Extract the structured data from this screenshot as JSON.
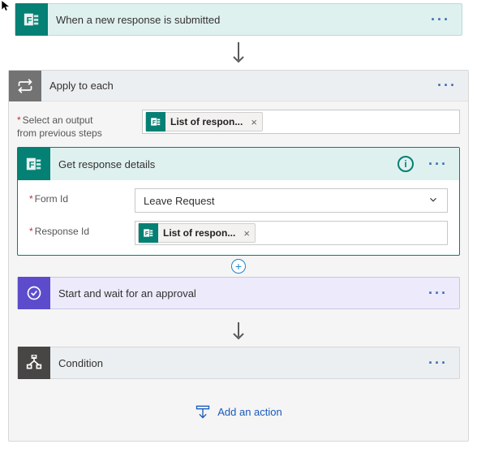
{
  "trigger": {
    "title": "When a new response is submitted"
  },
  "applyToEach": {
    "title": "Apply to each",
    "selectOutputLabel": "Select an output",
    "selectOutputLabel2": "from previous steps",
    "outputToken": "List of respon..."
  },
  "getResponse": {
    "title": "Get response details",
    "formIdLabel": "Form Id",
    "formIdValue": "Leave Request",
    "responseIdLabel": "Response Id",
    "responseToken": "List of respon..."
  },
  "approval": {
    "title": "Start and wait for an approval"
  },
  "condition": {
    "title": "Condition"
  },
  "addAction": "Add an action"
}
